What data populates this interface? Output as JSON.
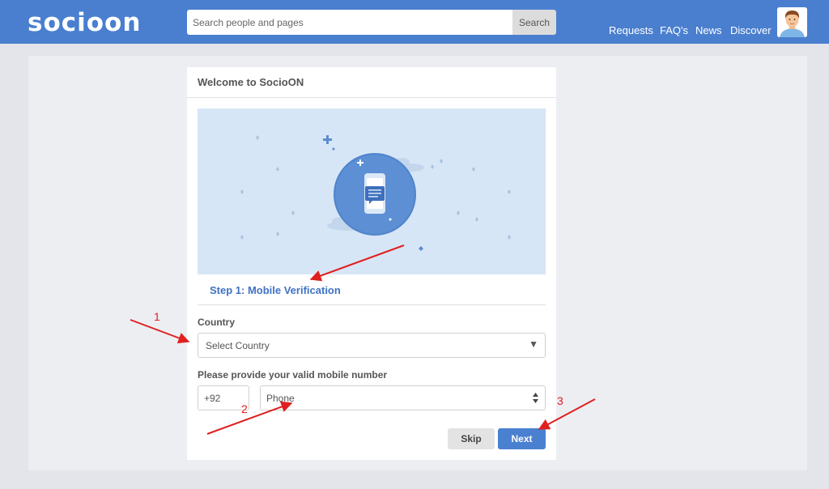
{
  "header": {
    "logo_text": "socioon",
    "search": {
      "placeholder": "Search people and pages",
      "button_label": "Search"
    },
    "nav": [
      "Requests",
      "FAQ's",
      "News",
      "Discover"
    ]
  },
  "card": {
    "title": "Welcome to SocioON",
    "step_title": "Step 1: Mobile Verification",
    "country": {
      "label": "Country",
      "selected": "Select Country"
    },
    "mobile": {
      "label": "Please provide your valid mobile number",
      "code": "+92",
      "placeholder": "Phone"
    },
    "buttons": {
      "skip": "Skip",
      "next": "Next"
    }
  },
  "annotations": {
    "numbers": [
      "1",
      "2",
      "3"
    ],
    "color": "#e02020"
  },
  "colors": {
    "header_bg": "#4a7fcf",
    "accent": "#3f72c4",
    "next_button": "#4a80d0",
    "illustration_bg": "#d7e6f6"
  }
}
